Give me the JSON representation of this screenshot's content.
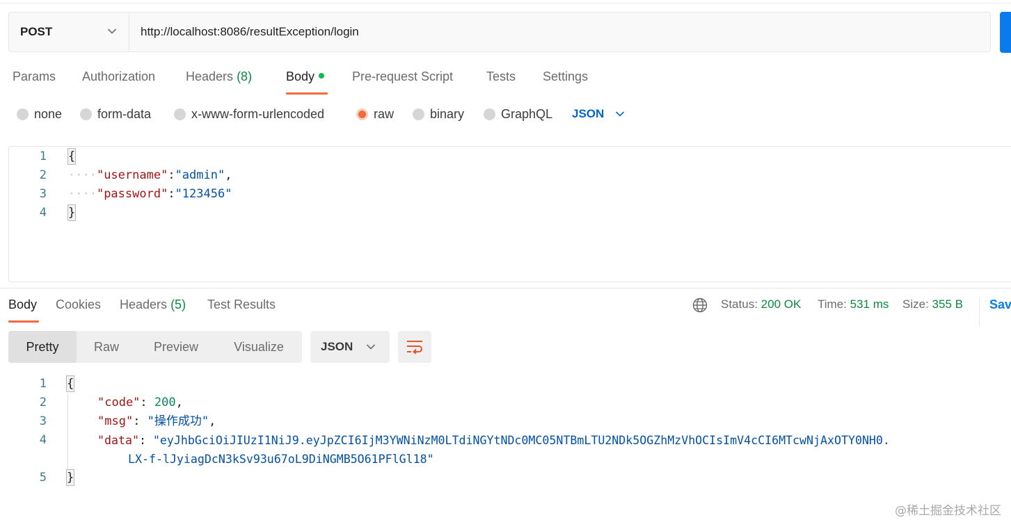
{
  "request": {
    "method": "POST",
    "url": "http://localhost:8086/resultException/login"
  },
  "request_tabs": {
    "params": "Params",
    "authorization": "Authorization",
    "headers": "Headers",
    "headers_count": "(8)",
    "body": "Body",
    "pre_request": "Pre-request Script",
    "tests": "Tests",
    "settings": "Settings"
  },
  "body_types": {
    "none": "none",
    "form_data": "form-data",
    "urlencoded": "x-www-form-urlencoded",
    "raw": "raw",
    "binary": "binary",
    "graphql": "GraphQL",
    "format": "JSON",
    "selected": "raw"
  },
  "request_body": {
    "line_numbers": [
      "1",
      "2",
      "3",
      "4"
    ],
    "open": "{",
    "close": "}",
    "indent": "····",
    "username_key": "\"username\"",
    "username_val": "\"admin\"",
    "password_key": "\"password\"",
    "password_val": "\"123456\""
  },
  "response_tabs": {
    "body": "Body",
    "cookies": "Cookies",
    "headers": "Headers",
    "headers_count": "(5)",
    "test_results": "Test Results"
  },
  "response_meta": {
    "status_label": "Status:",
    "status_value": "200 OK",
    "time_label": "Time:",
    "time_value": "531 ms",
    "size_label": "Size:",
    "size_value": "355 B",
    "save_label": "Sav"
  },
  "view_modes": {
    "pretty": "Pretty",
    "raw": "Raw",
    "preview": "Preview",
    "visualize": "Visualize",
    "format": "JSON",
    "active": "Pretty"
  },
  "response_body": {
    "line_numbers": [
      "1",
      "2",
      "3",
      "4",
      "5"
    ],
    "open": "{",
    "close": "}",
    "code_key": "\"code\"",
    "code_val": "200",
    "msg_key": "\"msg\"",
    "msg_val": "\"操作成功\"",
    "data_key": "\"data\"",
    "data_val_1": "\"eyJhbGciOiJIUzI1NiJ9.eyJpZCI6IjM3YWNiNzM0LTdiNGYtNDc0MC05NTBmLTU2NDk5OGZhMzVhOCIsImV4cCI6MTcwNjAxOTY0NH0.",
    "data_val_2": "LX-f-lJyiagDcN3kSv93u67oL9DiNGMB5O61PFlGl18\""
  },
  "watermark": "@稀土掘金技术社区",
  "colors": {
    "accent": "#f26b3a",
    "primary_blue": "#097bed",
    "status_green": "#0b8a3e",
    "json_key": "#a31515",
    "json_string": "#0451a5",
    "json_number": "#098658"
  }
}
